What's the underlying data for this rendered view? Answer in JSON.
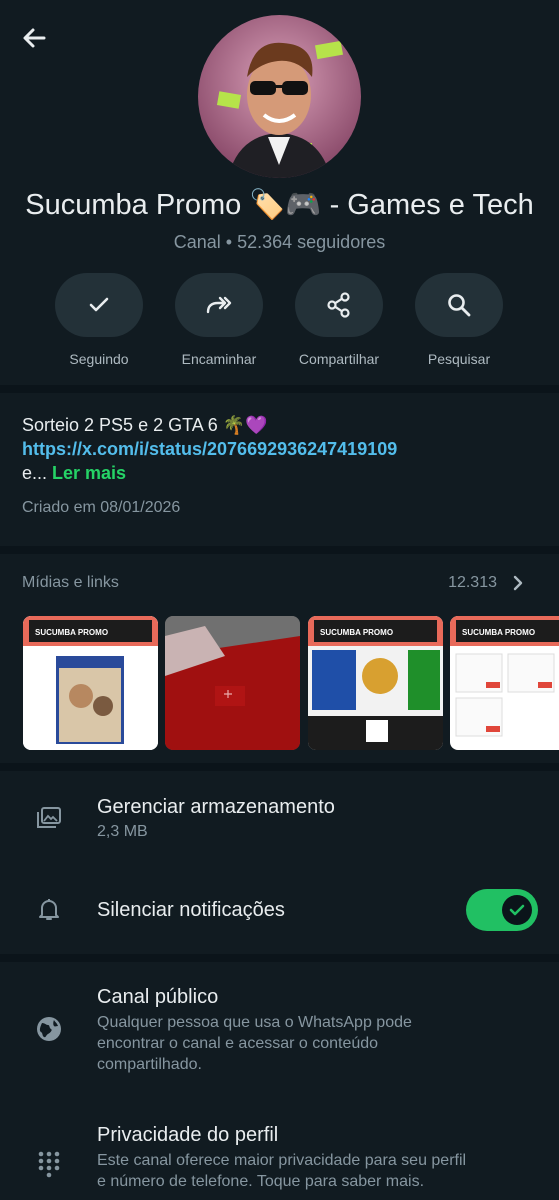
{
  "header": {
    "title": "Sucumba Promo 🏷️🎮  - Games e Tech",
    "subtitle": "Canal • 52.364 seguidores"
  },
  "actions": [
    {
      "label": "Seguindo",
      "icon": "check-icon"
    },
    {
      "label": "Encaminhar",
      "icon": "forward-icon"
    },
    {
      "label": "Compartilhar",
      "icon": "share-icon"
    },
    {
      "label": "Pesquisar",
      "icon": "search-icon"
    }
  ],
  "description": {
    "line1": "Sorteio 2 PS5 e 2 GTA 6 🌴💜",
    "link": "https://x.com/i/status/2076692936247419109",
    "ellipsis": "e... ",
    "read_more": "Ler mais",
    "created": "Criado em 08/01/2026"
  },
  "media": {
    "header": "Mídias e links",
    "count": "12.313",
    "thumb_labels": [
      "SUCUMBA PROMO",
      "SUCUMBA PROMO",
      "SUCUMBA PROMO"
    ]
  },
  "settings": {
    "storage_title": "Gerenciar armazenamento",
    "storage_size": "2,3 MB",
    "mute_title": "Silenciar notificações",
    "mute_on": true,
    "public_title": "Canal público",
    "public_desc": "Qualquer pessoa que usa o WhatsApp pode encontrar o canal e acessar o conteúdo compartilhado.",
    "privacy_title": "Privacidade do perfil",
    "privacy_desc": "Este canal oferece maior privacidade para seu perfil e número de telefone. Toque para saber mais."
  },
  "colors": {
    "background": "#0b141a",
    "panel": "#111b21",
    "accent_green": "#21c063",
    "link_blue": "#53bdeb",
    "muted": "#8696a0"
  }
}
